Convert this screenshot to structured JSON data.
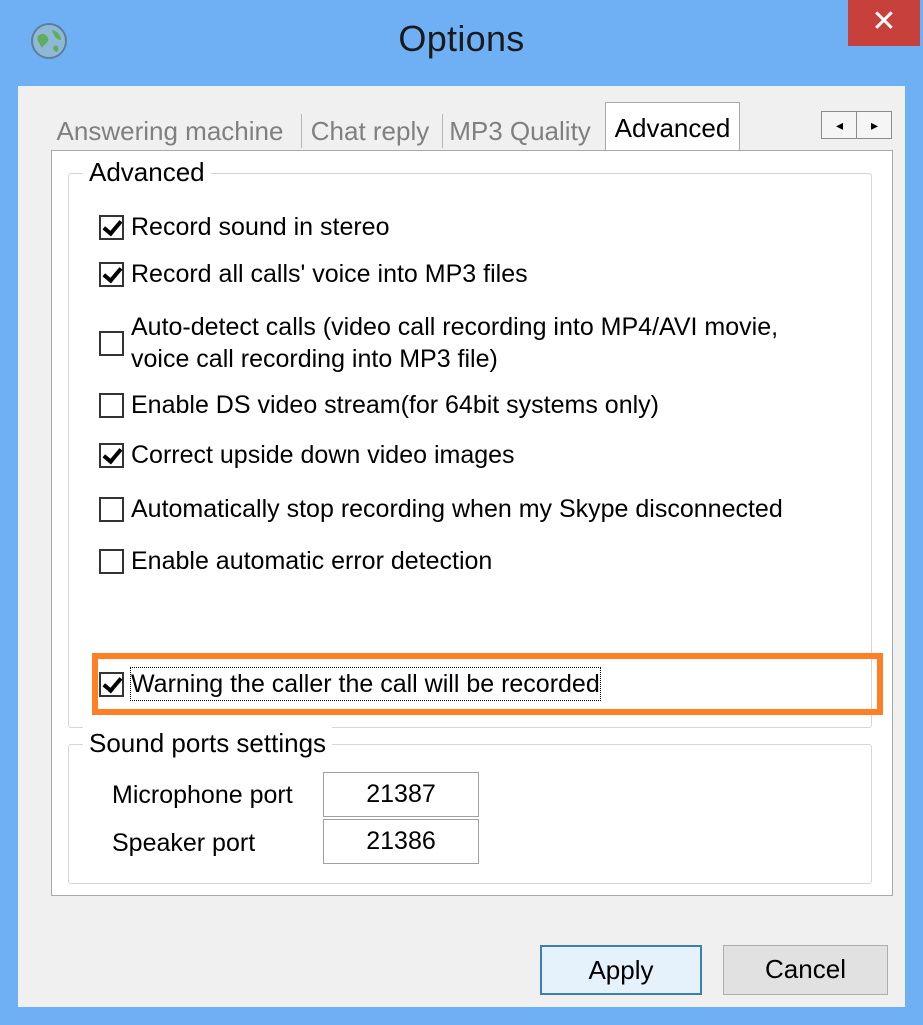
{
  "window": {
    "title": "Options",
    "close_glyph": "✕",
    "app_icon": "globe-icon"
  },
  "tabs": [
    {
      "label": "Answering machine",
      "active": false
    },
    {
      "label": "Chat reply",
      "active": false
    },
    {
      "label": "MP3 Quality",
      "active": false
    },
    {
      "label": "Advanced",
      "active": true
    }
  ],
  "tab_scroll": {
    "left_glyph": "◂",
    "right_glyph": "▸"
  },
  "advanced_group": {
    "title": "Advanced",
    "options": [
      {
        "label": "Record sound in stereo",
        "checked": true
      },
      {
        "label": "Record all calls' voice into MP3 files",
        "checked": true
      },
      {
        "label": "Auto-detect calls (video call recording into MP4/AVI movie, voice call recording into MP3 file)",
        "checked": false
      },
      {
        "label": "Enable DS video stream(for 64bit systems only)",
        "checked": false
      },
      {
        "label": "Correct upside down video images",
        "checked": true
      },
      {
        "label": "Automatically stop recording when my Skype disconnected",
        "checked": false
      },
      {
        "label": "Enable automatic error detection",
        "checked": false
      },
      {
        "label": "Warning the caller the call will be recorded",
        "checked": true,
        "highlighted": true
      }
    ]
  },
  "sound_ports": {
    "title": "Sound ports settings",
    "microphone": {
      "label": "Microphone port",
      "value": "21387"
    },
    "speaker": {
      "label": "Speaker port",
      "value": "21386"
    }
  },
  "buttons": {
    "apply": "Apply",
    "cancel": "Cancel"
  },
  "colors": {
    "title_bar": "#6fb0f5",
    "close_button": "#c6413c",
    "highlight": "#ff7f27"
  }
}
